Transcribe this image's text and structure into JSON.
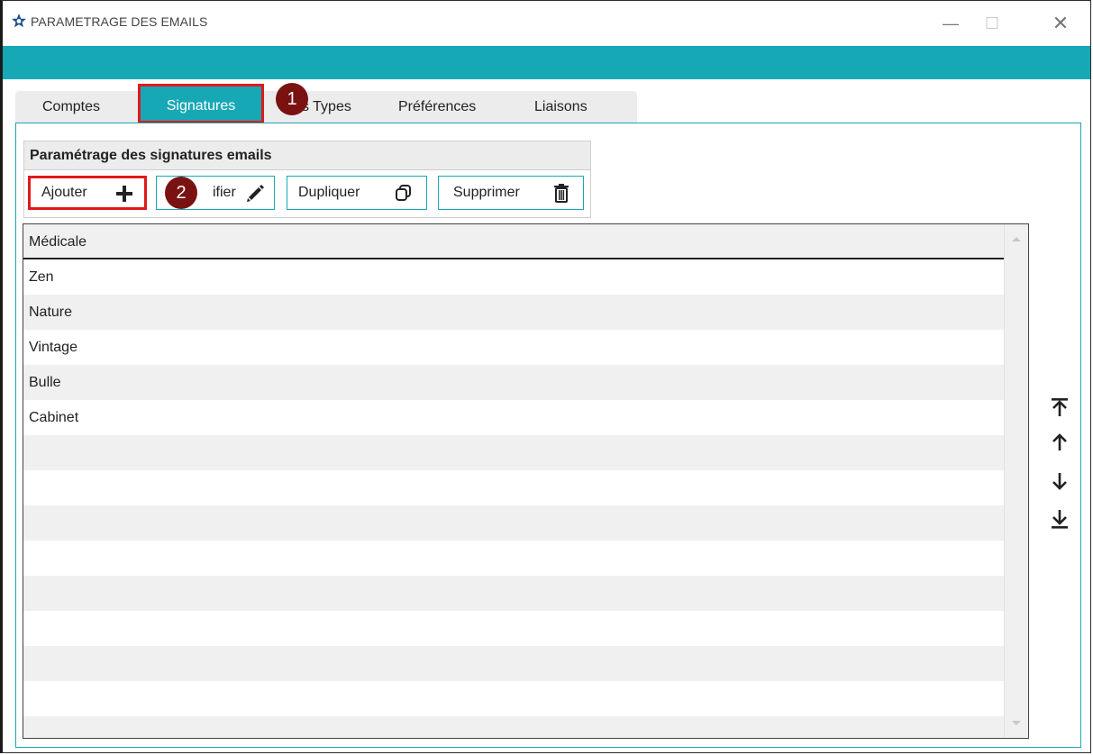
{
  "window": {
    "title": "PARAMETRAGE DES EMAILS",
    "minimize_glyph": "—",
    "maximize_glyph": "☐",
    "close_glyph": "✕",
    "accent_color": "#17a8b5",
    "highlight_color": "#e0191b"
  },
  "tabs": [
    {
      "label": "Comptes"
    },
    {
      "label": "Signatures",
      "selected": true
    },
    {
      "label": "Emails Types"
    },
    {
      "label": "Préférences"
    },
    {
      "label": "Liaisons"
    }
  ],
  "tabs_visible_partial": {
    "types_suffix": "s Types"
  },
  "annotations": [
    "1",
    "2"
  ],
  "group": {
    "title": "Paramétrage des signatures emails",
    "buttons": {
      "add": {
        "label": "Ajouter",
        "icon": "plus-icon"
      },
      "edit": {
        "label": "ifier",
        "icon": "pencil-icon"
      },
      "duplicate": {
        "label": "Dupliquer",
        "icon": "copy-icon"
      },
      "delete": {
        "label": "Supprimer",
        "icon": "trash-icon"
      }
    }
  },
  "list": {
    "rows": [
      "Médicale",
      "Zen",
      "Nature",
      "Vintage",
      "Bulle",
      "Cabinet"
    ]
  },
  "order_controls": [
    "move-to-top-icon",
    "move-up-icon",
    "move-down-icon",
    "move-to-bottom-icon"
  ]
}
